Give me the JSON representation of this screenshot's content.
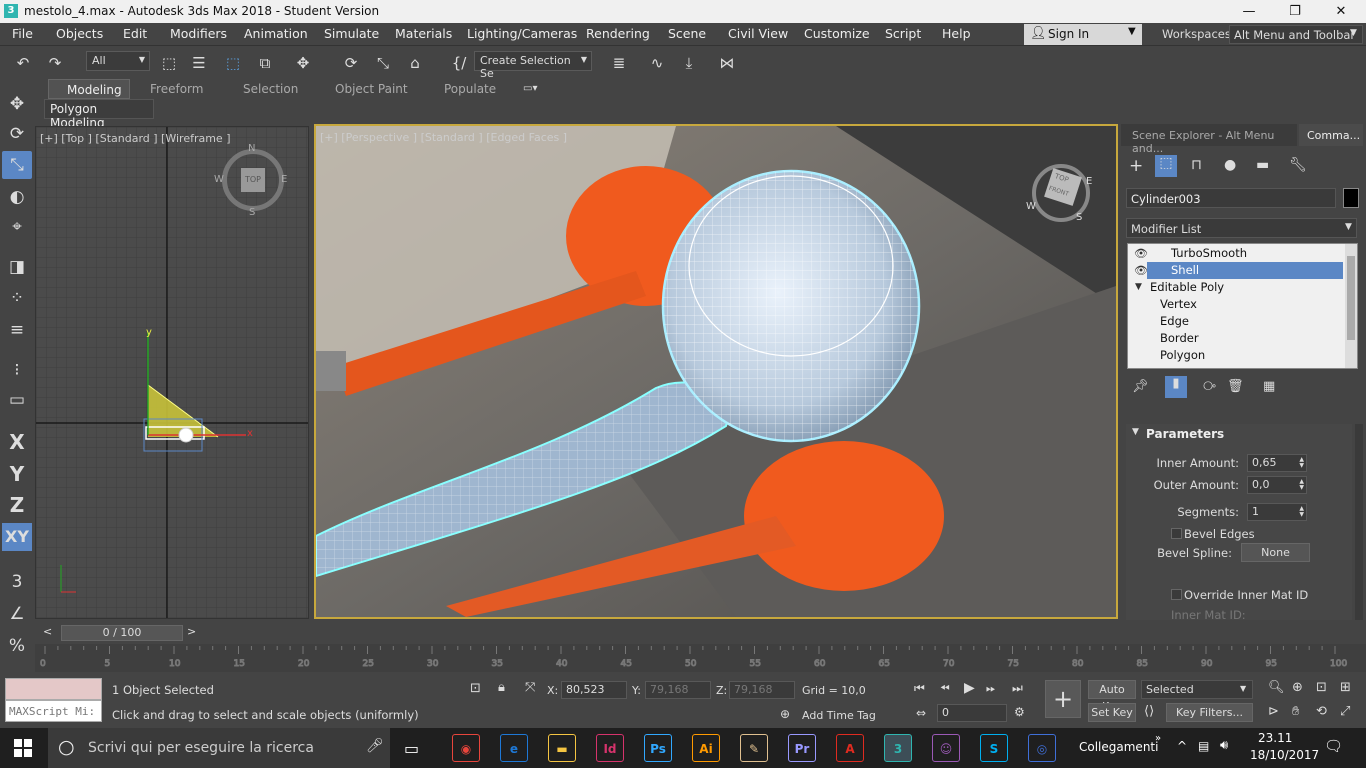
{
  "window": {
    "title": "mestolo_4.max - Autodesk 3ds Max 2018 - Student Version"
  },
  "menu": [
    "File",
    "Objects",
    "Edit",
    "Modifiers",
    "Animation",
    "Simulate",
    "Materials",
    "Lighting/Cameras",
    "Rendering",
    "Scene",
    "Civil View",
    "Customize",
    "Script",
    "Help"
  ],
  "account": {
    "sign_in": "Sign In"
  },
  "workspaces": {
    "label": "Workspaces:",
    "value": "Alt Menu and Toolbar"
  },
  "toolbar": {
    "filter": "All",
    "selection_set": "Create Selection Se"
  },
  "ribbon": {
    "tabs": [
      "Modeling",
      "Freeform",
      "Selection",
      "Object Paint",
      "Populate"
    ],
    "subtab": "Polygon Modeling"
  },
  "left_tools": {
    "axis_x": "X",
    "axis_y": "Y",
    "axis_z": "Z",
    "axis_xy": "XY"
  },
  "viewport_top": {
    "label": "[+] [Top ] [Standard ] [Wireframe ]",
    "compass": {
      "n": "N",
      "s": "S",
      "e": "E",
      "w": "W",
      "cube": "TOP"
    }
  },
  "viewport_persp": {
    "label": "[+] [Perspective ] [Standard ] [Edged Faces ]",
    "cube_top": "TOP",
    "cube_front": "FRONT",
    "compass_w": "W",
    "compass_e": "E",
    "compass_s": "S"
  },
  "command_panel": {
    "tabs": [
      "Scene Explorer - Alt Menu and...",
      "Comma..."
    ],
    "object_name": "Cylinder003",
    "modifier_list": "Modifier List",
    "stack": [
      {
        "label": "TurboSmooth",
        "selected": false
      },
      {
        "label": "Shell",
        "selected": true
      },
      {
        "label": "Editable Poly",
        "selected": false
      },
      {
        "label": "Vertex",
        "selected": false
      },
      {
        "label": "Edge",
        "selected": false
      },
      {
        "label": "Border",
        "selected": false
      },
      {
        "label": "Polygon",
        "selected": false
      }
    ],
    "rollout": "Parameters",
    "params": {
      "inner_amount_label": "Inner Amount:",
      "inner_amount": "0,65",
      "outer_amount_label": "Outer Amount:",
      "outer_amount": "0,0",
      "segments_label": "Segments:",
      "segments": "1",
      "bevel_edges": "Bevel Edges",
      "bevel_spline_label": "Bevel Spline:",
      "bevel_spline": "None",
      "override_inner": "Override Inner Mat ID",
      "inner_mat_id": "Inner Mat ID:"
    }
  },
  "timeline": {
    "frame": "0 / 100",
    "ticks": [
      "0",
      "5",
      "10",
      "15",
      "20",
      "25",
      "30",
      "35",
      "40",
      "45",
      "50",
      "55",
      "60",
      "65",
      "70",
      "75",
      "80",
      "85",
      "90",
      "95",
      "100"
    ]
  },
  "status": {
    "maxscript": "MAXScript Mi:",
    "selection": "1 Object Selected",
    "prompt": "Click and drag to select and scale objects (uniformly)",
    "x_label": "X:",
    "x": "80,523",
    "y_label": "Y:",
    "y": "79,168",
    "z_label": "Z:",
    "z": "79,168",
    "grid": "Grid = 10,0",
    "add_time_tag": "Add Time Tag",
    "auto_key": "Auto Key",
    "set_key": "Set Key",
    "selected": "Selected",
    "key_filters": "Key Filters...",
    "frame": "0"
  },
  "taskbar": {
    "search": "Scrivi qui per eseguire la ricerca",
    "links": "Collegamenti",
    "time": "23.11",
    "date": "18/10/2017",
    "apps": [
      {
        "name": "chrome",
        "text": "◉",
        "color": "#e8453c"
      },
      {
        "name": "edge",
        "text": "e",
        "color": "#1e78d6"
      },
      {
        "name": "explorer",
        "text": "▬",
        "color": "#f5c542"
      },
      {
        "name": "indesign",
        "text": "Id",
        "color": "#d6336c"
      },
      {
        "name": "photoshop",
        "text": "Ps",
        "color": "#31a8ff"
      },
      {
        "name": "illustrator",
        "text": "Ai",
        "color": "#ff9a00"
      },
      {
        "name": "paint",
        "text": "✎",
        "color": "#e0c090"
      },
      {
        "name": "premiere",
        "text": "Pr",
        "color": "#9999ff"
      },
      {
        "name": "acrobat",
        "text": "A",
        "color": "#e02b20"
      },
      {
        "name": "3dsmax",
        "text": "3",
        "color": "#2fb5b0"
      },
      {
        "name": "app-cat",
        "text": "☺",
        "color": "#9b59b6"
      },
      {
        "name": "skype",
        "text": "S",
        "color": "#00aff0"
      },
      {
        "name": "app-circle",
        "text": "◎",
        "color": "#3f6fd8"
      }
    ]
  },
  "colors": {
    "accent": "#5b87c5",
    "viewport_border": "#c7a83d",
    "ladle": "#f05a1e"
  }
}
